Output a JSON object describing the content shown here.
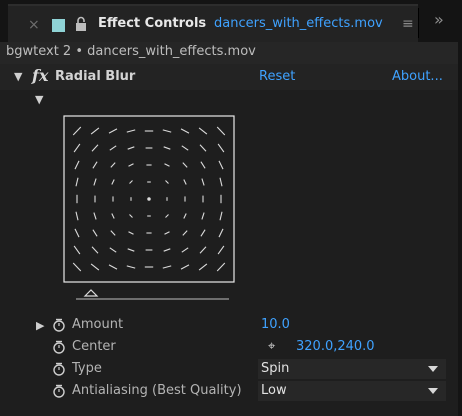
{
  "tab": {
    "close_icon": "×",
    "title": "Effect Controls",
    "file": "dancers_with_effects.mov",
    "menu_icon": "≡",
    "overflow_icon": "»"
  },
  "source": {
    "text": "bgwtext 2 • dancers_with_effects.mov"
  },
  "effect": {
    "fx_label": "fx",
    "name": "Radial Blur",
    "reset": "Reset",
    "about": "About...",
    "expand_icon": "▼",
    "preview_expand_icon": "▼"
  },
  "params": [
    {
      "label": "Amount",
      "value": "10.0",
      "expandable": true,
      "expand_icon": "▶"
    },
    {
      "label": "Center",
      "value": "320.0,240.0",
      "target_icon": "⌖"
    },
    {
      "label": "Type",
      "value": "Spin"
    },
    {
      "label": "Antialiasing (Best Quality)",
      "value": "Low"
    }
  ],
  "colors": {
    "accent": "#3fa2ff",
    "swatch": "#8fd3d6",
    "panel": "#1e1e1e"
  }
}
